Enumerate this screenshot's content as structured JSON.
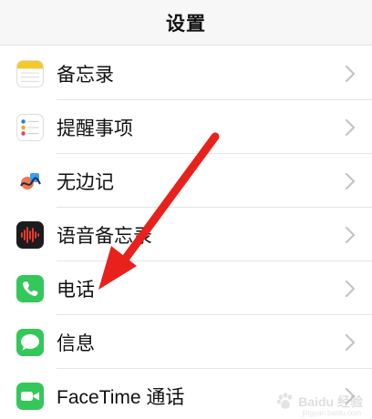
{
  "header": {
    "title": "设置"
  },
  "rows": [
    {
      "label": "备忘录",
      "icon": "notes-icon"
    },
    {
      "label": "提醒事项",
      "icon": "reminders-icon"
    },
    {
      "label": "无边记",
      "icon": "freeform-icon"
    },
    {
      "label": "语音备忘录",
      "icon": "voice-memos-icon"
    },
    {
      "label": "电话",
      "icon": "phone-icon"
    },
    {
      "label": "信息",
      "icon": "messages-icon"
    },
    {
      "label": "FaceTime 通话",
      "icon": "facetime-icon"
    }
  ],
  "annotation": {
    "color": "#e8211d",
    "icon": "red-arrow-pointing-to-phone"
  },
  "watermark": {
    "text": "Baidu 经验",
    "sub": "jingyan.baidu.com"
  },
  "colors": {
    "green": "#34c759",
    "chevron": "#c4c4c7",
    "divider": "#e5e5ea"
  }
}
